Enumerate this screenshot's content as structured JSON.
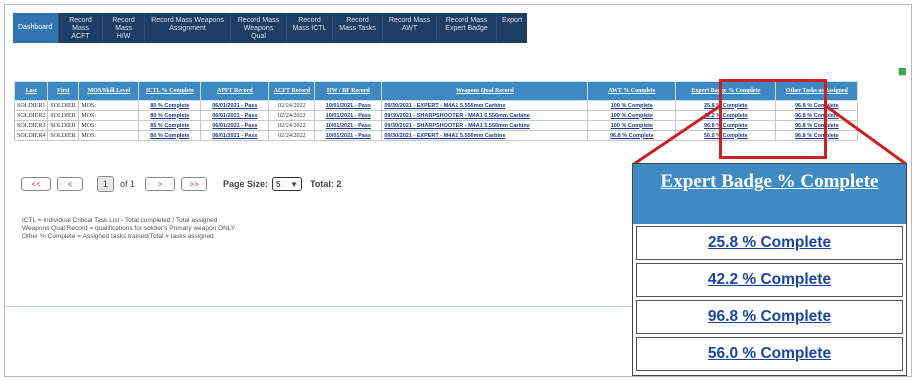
{
  "nav": {
    "items": [
      {
        "label": "Dashboard",
        "active": true
      },
      {
        "label": "Record Mass ACFT"
      },
      {
        "label": "Record Mass H/W"
      },
      {
        "label": "Record Mass Weapons Assignment"
      },
      {
        "label": "Record Mass Weapons Qual"
      },
      {
        "label": "Record Mass ICTL"
      },
      {
        "label": "Record Mass Tasks"
      },
      {
        "label": "Record Mass AWT"
      },
      {
        "label": "Record Mass Expert Badge"
      },
      {
        "label": "Export"
      }
    ]
  },
  "export_icon": "excel-icon",
  "table": {
    "headers": [
      "Last",
      "First",
      "MOS/Skill Level",
      "ICTL % Complete",
      "APFT Record",
      "ACFT Record",
      "HW / BF Record",
      "Weapons Qual Record",
      "AWT % Complete",
      "Expert Badge % Complete",
      "Other Tasks as Assigned"
    ],
    "rows": [
      {
        "last": "SOLDIER1",
        "first": "SOLDIER",
        "mos": "MOS:",
        "ictl": "80 % Complete",
        "apft": "06/01/2021 - Pass",
        "acft": "02/24/2022",
        "hw": "10/01/2021 - Pass",
        "weapons": "09/30/2021 - EXPERT - M4A1 5.556mm Carbine",
        "awt": "100 % Complete",
        "expert": "25.8 % Complete",
        "other": "96.8 % Complete"
      },
      {
        "last": "SOLDIER2",
        "first": "SOLDIER",
        "mos": "MOS:",
        "ictl": "80 % Complete",
        "apft": "06/01/2021 - Pass",
        "acft": "02/24/2022",
        "hw": "10/01/2021 - Pass",
        "weapons": "09/30/2021 - SHARPSHOOTER - M4A1 5.556mm Carbine",
        "awt": "100 % Complete",
        "expert": "42.2 % Complete",
        "other": "96.8 % Complete"
      },
      {
        "last": "SOLDIER3",
        "first": "SOLDIER",
        "mos": "MOS:",
        "ictl": "85 % Complete",
        "apft": "06/01/2021 - Pass",
        "acft": "02/24/2022",
        "hw": "10/01/2021 - Pass",
        "weapons": "09/30/2021 - SHARPSHOOTER - M4A1 5.556mm Carbine",
        "awt": "100 % Complete",
        "expert": "96.8 % Complete",
        "other": "96.8 % Complete"
      },
      {
        "last": "SOLDIER4",
        "first": "SOLDIER",
        "mos": "MOS:",
        "ictl": "80 % Complete",
        "apft": "06/01/2021 - Pass",
        "acft": "02/24/2022",
        "hw": "10/01/2021 - Pass",
        "weapons": "09/30/2021 - EXPERT - M4A1 5.556mm Carbine",
        "awt": "96.8 % Complete",
        "expert": "56.0 % Complete",
        "other": "96.8 % Complete"
      }
    ]
  },
  "pager": {
    "first": "<<",
    "prev": "<",
    "current": "1",
    "of_text": "of 1",
    "next": ">",
    "last": ">>",
    "page_size_label": "Page Size:",
    "page_size": "5",
    "total": "Total: 2"
  },
  "notes": [
    "ICTL = Individual Critical Task List - Total completed / Total assigned.",
    "Weapons Qual Record = qualifications for soldier's Primary weapon ONLY.",
    "Other % Complete = Assigned tasks trained/Total # tasks assigned."
  ],
  "zoom": {
    "header": "Expert Badge % Complete",
    "values": [
      "25.8 % Complete",
      "42.2 % Complete",
      "96.8 % Complete",
      "56.0 % Complete"
    ]
  },
  "colors": {
    "nav_bg": "#1f3e63",
    "nav_active": "#2f76b0",
    "header_bg": "#3f89c2",
    "highlight": "#cc2020",
    "link": "#1a3c8a"
  }
}
